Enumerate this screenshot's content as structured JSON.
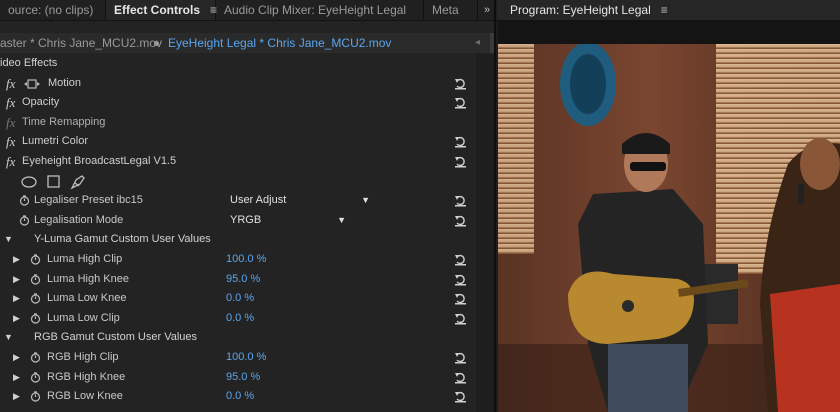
{
  "tabs": {
    "source": "ource: (no clips)",
    "effect_controls": "Effect Controls",
    "audio_mixer": "Audio Clip Mixer: EyeHeight Legal",
    "metadata": "Meta",
    "program": "Program: EyeHeight Legal",
    "menu_glyph": "≡",
    "overflow_glyph": "»"
  },
  "clipbar": {
    "master": "aster * Chris Jane_MCU2.mov",
    "sequence": "EyeHeight Legal * Chris Jane_MCU2.mov"
  },
  "rows": {
    "video_effects": "ideo Effects",
    "motion": "Motion",
    "opacity": "Opacity",
    "time_remapping": "Time Remapping",
    "lumetri": "Lumetri Color",
    "eyeheight": "Eyeheight BroadcastLegal V1.5",
    "legaliser_preset": "Legaliser Preset ibc15",
    "legaliser_preset_value": "User Adjust",
    "legalisation_mode": "Legalisation Mode",
    "legalisation_mode_value": "YRGB",
    "y_luma_group": "Y-Luma Gamut Custom User Values",
    "luma_high_clip": "Luma High Clip",
    "luma_high_clip_value": "100.0 %",
    "luma_high_knee": "Luma High Knee",
    "luma_high_knee_value": "95.0 %",
    "luma_low_knee": "Luma Low Knee",
    "luma_low_knee_value": "0.0 %",
    "luma_low_clip": "Luma Low Clip",
    "luma_low_clip_value": "0.0 %",
    "rgb_group": "RGB Gamut Custom User Values",
    "rgb_high_clip": "RGB High Clip",
    "rgb_high_clip_value": "100.0 %",
    "rgb_high_knee": "RGB High Knee",
    "rgb_high_knee_value": "95.0 %",
    "rgb_low_knee": "RGB Low Knee",
    "rgb_low_knee_value": "0.0 %",
    "fx_glyph": "fx"
  },
  "colors": {
    "accent_blue": "#5aa6ee",
    "panel_bg": "#232323"
  }
}
